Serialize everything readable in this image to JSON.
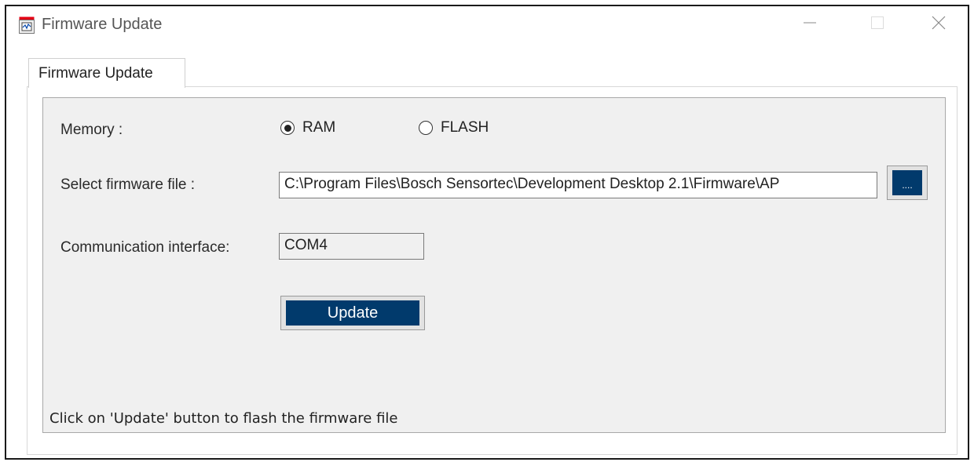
{
  "window": {
    "title": "Firmware Update",
    "icons": {
      "app": "bosch-app-icon",
      "minimize": "minimize-icon",
      "maximize": "maximize-icon",
      "close": "close-icon"
    }
  },
  "tabs": [
    {
      "label": "Firmware Update",
      "active": true
    }
  ],
  "form": {
    "memory_label": "Memory :",
    "memory_options": [
      {
        "label": "RAM",
        "selected": true
      },
      {
        "label": "FLASH",
        "selected": false
      }
    ],
    "firmware_label": "Select firmware file :",
    "firmware_path": "C:\\Program Files\\Bosch Sensortec\\Development Desktop 2.1\\Firmware\\AP",
    "browse_label": "....",
    "interface_label": "Communication interface:",
    "interface_value": "COM4",
    "update_label": "Update"
  },
  "status": "Click on 'Update' button to flash the firmware file",
  "colors": {
    "button_blue": "#013a6c",
    "panel_bg": "#f0f0f0"
  }
}
